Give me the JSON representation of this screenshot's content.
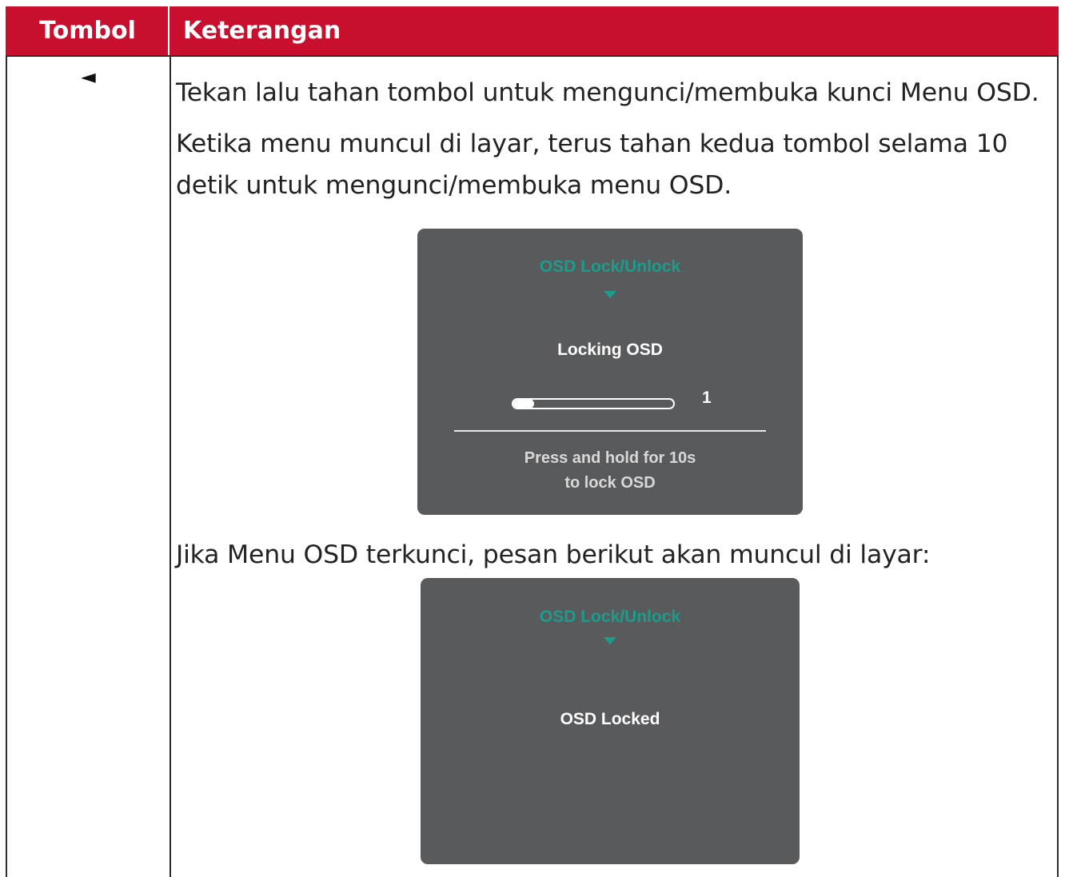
{
  "table": {
    "header": {
      "button_col": "Tombol",
      "description_col": "Keterangan"
    },
    "row": {
      "button_glyph": "◄",
      "paragraphs": [
        "Tekan lalu tahan tombol untuk mengunci/membuka kunci Menu OSD.",
        "Ketika menu muncul di layar, terus tahan kedua tombol selama 10 detik untuk mengunci/membuka menu OSD.",
        "Jika Menu OSD terkunci, pesan berikut akan muncul di layar:"
      ]
    }
  },
  "osd_locking": {
    "title": "OSD Lock/Unlock",
    "status": "Locking OSD",
    "progress_value": "1",
    "progress_fraction": 0.1,
    "hint_line1": "Press and hold for 10s",
    "hint_line2": "to lock OSD"
  },
  "osd_locked": {
    "title": "OSD Lock/Unlock",
    "status": "OSD Locked"
  },
  "colors": {
    "header_background": "#c8102e",
    "osd_background": "#595a5c",
    "osd_accent": "#1a9d8c"
  }
}
